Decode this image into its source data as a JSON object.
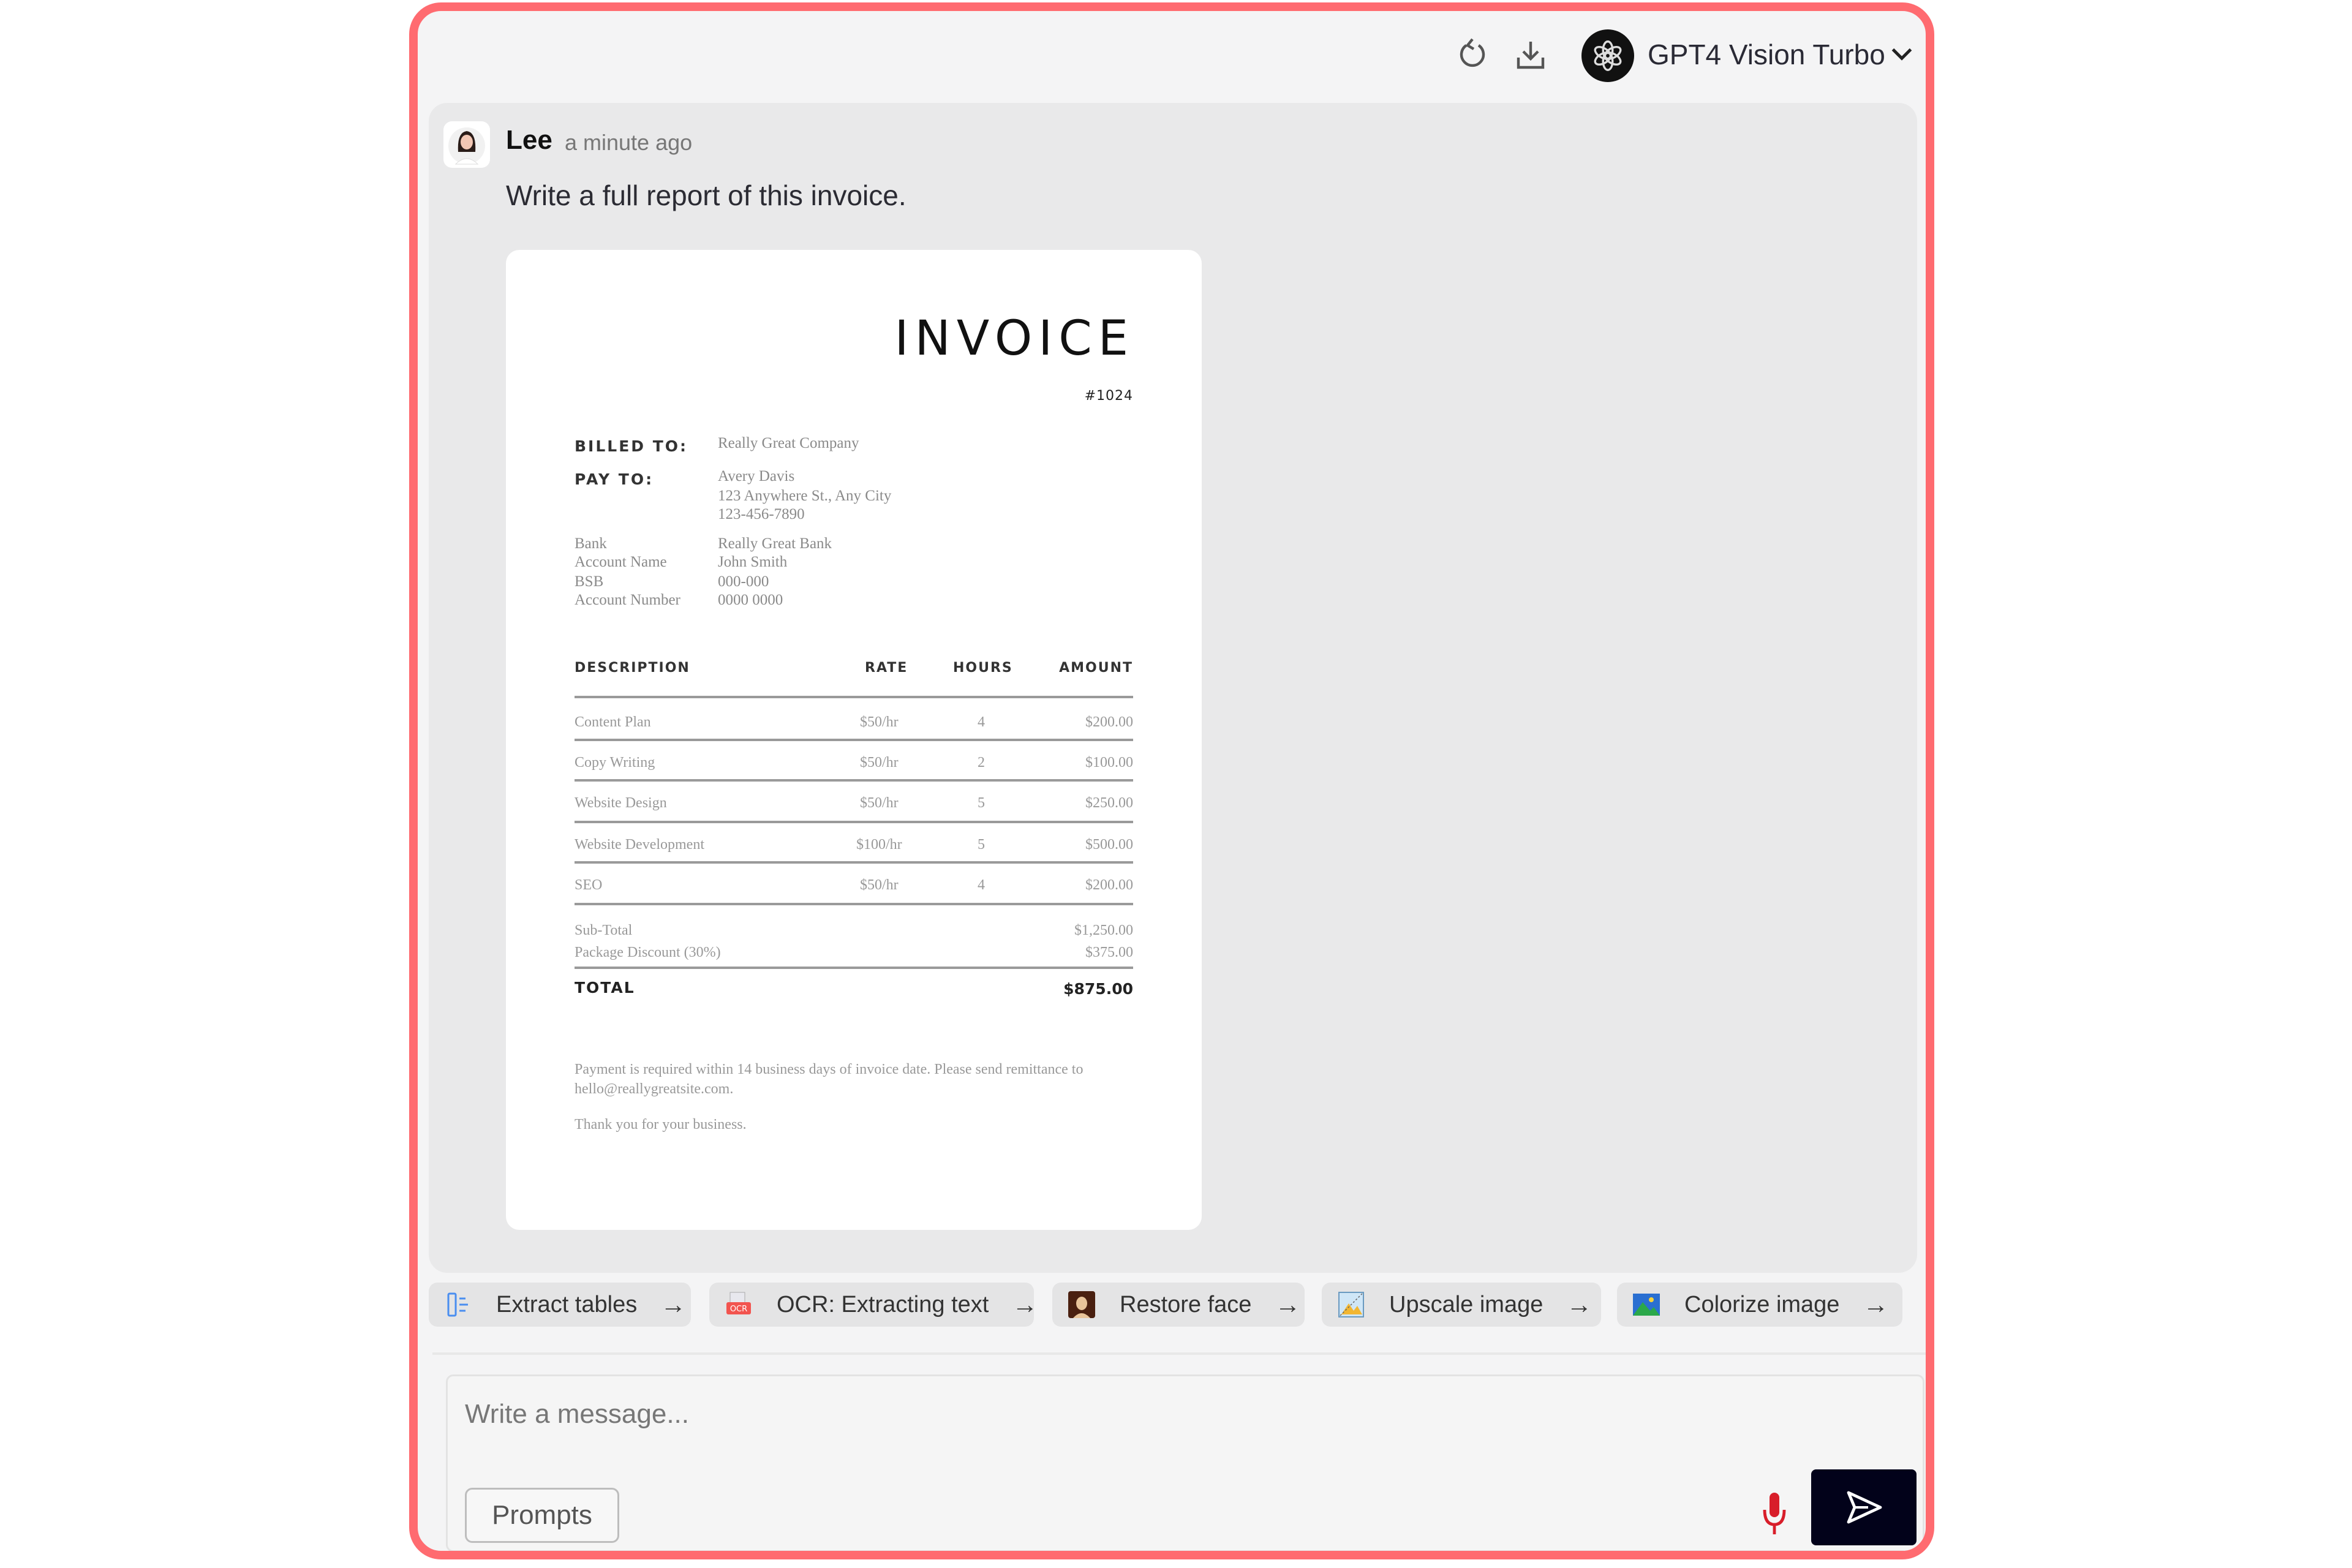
{
  "header": {
    "refresh_icon": "refresh-icon",
    "download_icon": "download-icon",
    "model_logo_icon": "openai-logo-icon",
    "model_name": "GPT4 Vision Turbo",
    "model_chevron_icon": "chevron-down-icon"
  },
  "message": {
    "author": "Lee",
    "timestamp": "a minute ago",
    "text": "Write a full report of this invoice.",
    "attachment": {
      "title": "INVOICE",
      "number": "#1024",
      "billed_to_label": "BILLED TO:",
      "billed_to": "Really Great Company",
      "pay_to_label": "PAY TO:",
      "pay_to_name": "Avery Davis",
      "pay_to_address": "123 Anywhere St., Any City",
      "pay_to_phone": "123-456-7890",
      "bank_details": [
        {
          "label": "Bank",
          "value": "Really Great Bank"
        },
        {
          "label": "Account Name",
          "value": "John Smith"
        },
        {
          "label": "BSB",
          "value": "000-000"
        },
        {
          "label": "Account Number",
          "value": "0000 0000"
        }
      ],
      "table": {
        "headers": [
          "DESCRIPTION",
          "RATE",
          "HOURS",
          "AMOUNT"
        ],
        "rows": [
          {
            "description": "Content Plan",
            "rate": "$50/hr",
            "hours": "4",
            "amount": "$200.00"
          },
          {
            "description": "Copy Writing",
            "rate": "$50/hr",
            "hours": "2",
            "amount": "$100.00"
          },
          {
            "description": "Website Design",
            "rate": "$50/hr",
            "hours": "5",
            "amount": "$250.00"
          },
          {
            "description": "Website Development",
            "rate": "$100/hr",
            "hours": "5",
            "amount": "$500.00"
          },
          {
            "description": "SEO",
            "rate": "$50/hr",
            "hours": "4",
            "amount": "$200.00"
          }
        ]
      },
      "subtotal_label": "Sub-Total",
      "subtotal": "$1,250.00",
      "discount_label": "Package Discount (30%)",
      "discount": "$375.00",
      "total_label": "TOTAL",
      "total": "$875.00",
      "payment_note": "Payment is required within 14 business days of invoice date. Please send remittance to hello@reallygreatsite.com.",
      "thanks": "Thank you for your business."
    }
  },
  "actions": [
    {
      "label": "Extract tables",
      "icon": "table-extract-icon",
      "arrow": "→"
    },
    {
      "label": "OCR: Extracting text",
      "icon": "ocr-icon",
      "arrow": "→"
    },
    {
      "label": "Restore face",
      "icon": "portrait-icon",
      "arrow": "→"
    },
    {
      "label": "Upscale image",
      "icon": "upscale-icon",
      "arrow": "→"
    },
    {
      "label": "Colorize image",
      "icon": "landscape-icon",
      "arrow": "→"
    }
  ],
  "composer": {
    "placeholder": "Write a message...",
    "value": "",
    "prompts_label": "Prompts",
    "mic_icon": "microphone-icon",
    "send_icon": "send-icon"
  },
  "colors": {
    "frame_border": "#ff6b70",
    "send_button": "#02021a",
    "mic": "#d81e2a"
  }
}
